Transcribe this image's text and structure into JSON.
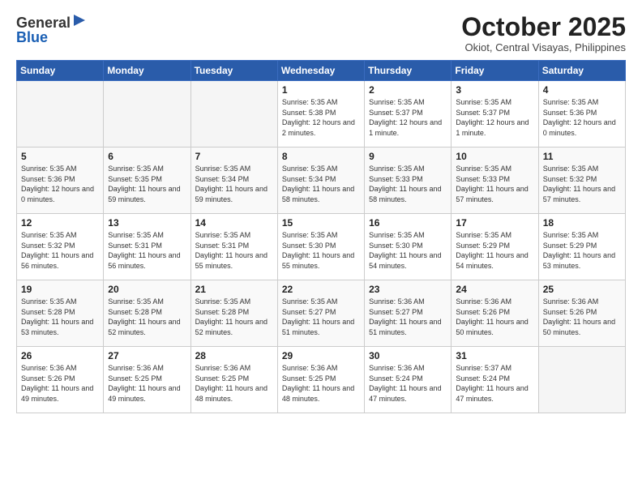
{
  "header": {
    "logo_line1": "General",
    "logo_line2": "Blue",
    "month": "October 2025",
    "location": "Okiot, Central Visayas, Philippines"
  },
  "days_of_week": [
    "Sunday",
    "Monday",
    "Tuesday",
    "Wednesday",
    "Thursday",
    "Friday",
    "Saturday"
  ],
  "weeks": [
    [
      {
        "day": "",
        "info": ""
      },
      {
        "day": "",
        "info": ""
      },
      {
        "day": "",
        "info": ""
      },
      {
        "day": "1",
        "info": "Sunrise: 5:35 AM\nSunset: 5:38 PM\nDaylight: 12 hours\nand 2 minutes."
      },
      {
        "day": "2",
        "info": "Sunrise: 5:35 AM\nSunset: 5:37 PM\nDaylight: 12 hours\nand 1 minute."
      },
      {
        "day": "3",
        "info": "Sunrise: 5:35 AM\nSunset: 5:37 PM\nDaylight: 12 hours\nand 1 minute."
      },
      {
        "day": "4",
        "info": "Sunrise: 5:35 AM\nSunset: 5:36 PM\nDaylight: 12 hours\nand 0 minutes."
      }
    ],
    [
      {
        "day": "5",
        "info": "Sunrise: 5:35 AM\nSunset: 5:36 PM\nDaylight: 12 hours\nand 0 minutes."
      },
      {
        "day": "6",
        "info": "Sunrise: 5:35 AM\nSunset: 5:35 PM\nDaylight: 11 hours\nand 59 minutes."
      },
      {
        "day": "7",
        "info": "Sunrise: 5:35 AM\nSunset: 5:34 PM\nDaylight: 11 hours\nand 59 minutes."
      },
      {
        "day": "8",
        "info": "Sunrise: 5:35 AM\nSunset: 5:34 PM\nDaylight: 11 hours\nand 58 minutes."
      },
      {
        "day": "9",
        "info": "Sunrise: 5:35 AM\nSunset: 5:33 PM\nDaylight: 11 hours\nand 58 minutes."
      },
      {
        "day": "10",
        "info": "Sunrise: 5:35 AM\nSunset: 5:33 PM\nDaylight: 11 hours\nand 57 minutes."
      },
      {
        "day": "11",
        "info": "Sunrise: 5:35 AM\nSunset: 5:32 PM\nDaylight: 11 hours\nand 57 minutes."
      }
    ],
    [
      {
        "day": "12",
        "info": "Sunrise: 5:35 AM\nSunset: 5:32 PM\nDaylight: 11 hours\nand 56 minutes."
      },
      {
        "day": "13",
        "info": "Sunrise: 5:35 AM\nSunset: 5:31 PM\nDaylight: 11 hours\nand 56 minutes."
      },
      {
        "day": "14",
        "info": "Sunrise: 5:35 AM\nSunset: 5:31 PM\nDaylight: 11 hours\nand 55 minutes."
      },
      {
        "day": "15",
        "info": "Sunrise: 5:35 AM\nSunset: 5:30 PM\nDaylight: 11 hours\nand 55 minutes."
      },
      {
        "day": "16",
        "info": "Sunrise: 5:35 AM\nSunset: 5:30 PM\nDaylight: 11 hours\nand 54 minutes."
      },
      {
        "day": "17",
        "info": "Sunrise: 5:35 AM\nSunset: 5:29 PM\nDaylight: 11 hours\nand 54 minutes."
      },
      {
        "day": "18",
        "info": "Sunrise: 5:35 AM\nSunset: 5:29 PM\nDaylight: 11 hours\nand 53 minutes."
      }
    ],
    [
      {
        "day": "19",
        "info": "Sunrise: 5:35 AM\nSunset: 5:28 PM\nDaylight: 11 hours\nand 53 minutes."
      },
      {
        "day": "20",
        "info": "Sunrise: 5:35 AM\nSunset: 5:28 PM\nDaylight: 11 hours\nand 52 minutes."
      },
      {
        "day": "21",
        "info": "Sunrise: 5:35 AM\nSunset: 5:28 PM\nDaylight: 11 hours\nand 52 minutes."
      },
      {
        "day": "22",
        "info": "Sunrise: 5:35 AM\nSunset: 5:27 PM\nDaylight: 11 hours\nand 51 minutes."
      },
      {
        "day": "23",
        "info": "Sunrise: 5:36 AM\nSunset: 5:27 PM\nDaylight: 11 hours\nand 51 minutes."
      },
      {
        "day": "24",
        "info": "Sunrise: 5:36 AM\nSunset: 5:26 PM\nDaylight: 11 hours\nand 50 minutes."
      },
      {
        "day": "25",
        "info": "Sunrise: 5:36 AM\nSunset: 5:26 PM\nDaylight: 11 hours\nand 50 minutes."
      }
    ],
    [
      {
        "day": "26",
        "info": "Sunrise: 5:36 AM\nSunset: 5:26 PM\nDaylight: 11 hours\nand 49 minutes."
      },
      {
        "day": "27",
        "info": "Sunrise: 5:36 AM\nSunset: 5:25 PM\nDaylight: 11 hours\nand 49 minutes."
      },
      {
        "day": "28",
        "info": "Sunrise: 5:36 AM\nSunset: 5:25 PM\nDaylight: 11 hours\nand 48 minutes."
      },
      {
        "day": "29",
        "info": "Sunrise: 5:36 AM\nSunset: 5:25 PM\nDaylight: 11 hours\nand 48 minutes."
      },
      {
        "day": "30",
        "info": "Sunrise: 5:36 AM\nSunset: 5:24 PM\nDaylight: 11 hours\nand 47 minutes."
      },
      {
        "day": "31",
        "info": "Sunrise: 5:37 AM\nSunset: 5:24 PM\nDaylight: 11 hours\nand 47 minutes."
      },
      {
        "day": "",
        "info": ""
      }
    ]
  ]
}
